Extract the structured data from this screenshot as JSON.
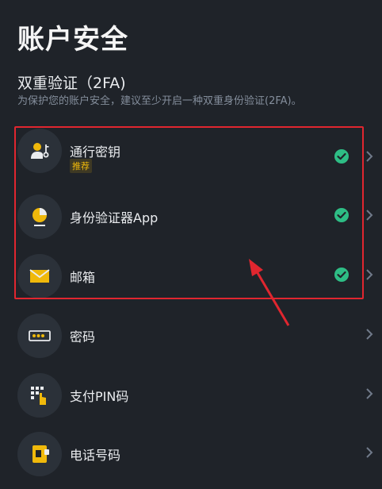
{
  "page": {
    "title": "账户安全"
  },
  "section": {
    "title": "双重验证（2FA)",
    "description": "为保护您的账户安全，建议至少开启一种双重身份验证(2FA)。"
  },
  "items": [
    {
      "label": "通行密钥",
      "tag": "推荐",
      "enabled": true,
      "icon": "passkey-icon"
    },
    {
      "label": "身份验证器App",
      "enabled": true,
      "icon": "authenticator-icon"
    },
    {
      "label": "邮箱",
      "enabled": true,
      "icon": "mail-icon"
    },
    {
      "label": "密码",
      "enabled": false,
      "icon": "password-icon"
    },
    {
      "label": "支付PIN码",
      "enabled": false,
      "icon": "pin-keypad-icon"
    },
    {
      "label": "电话号码",
      "enabled": false,
      "icon": "phone-icon"
    }
  ],
  "colors": {
    "background": "#1f2329",
    "icon_bg": "#2b3139",
    "accent": "#f0b90b",
    "check": "#2ebd85",
    "annotation": "#e0262f"
  }
}
